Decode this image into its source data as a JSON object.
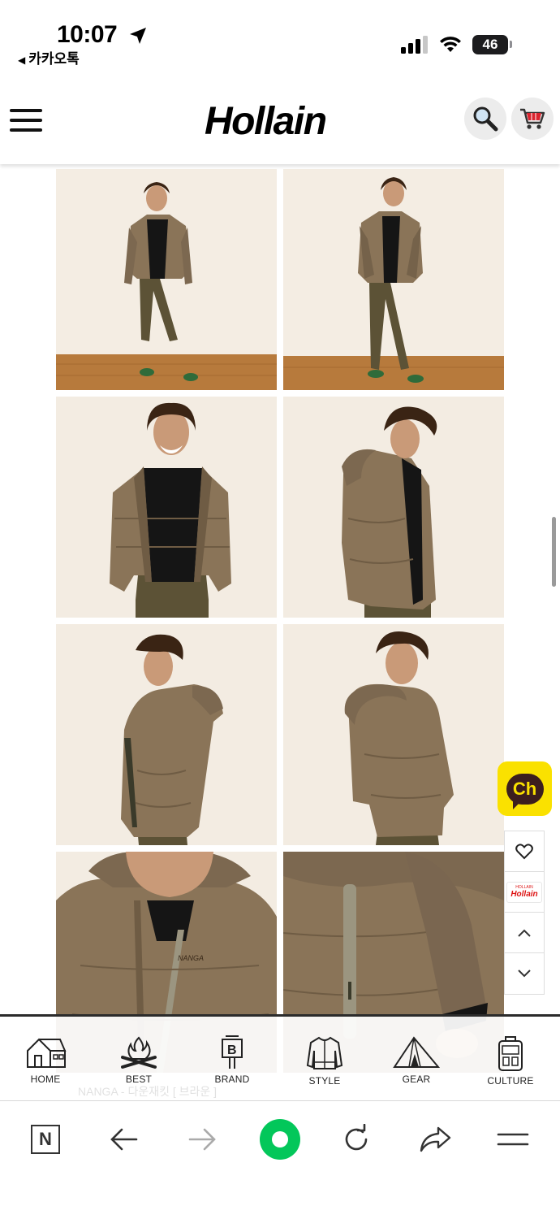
{
  "status_bar": {
    "time": "10:07",
    "back_app": "카카오톡",
    "battery": "46",
    "icons": [
      "location-arrow-icon",
      "cellular-signal-icon",
      "wifi-icon",
      "battery-icon"
    ]
  },
  "header": {
    "logo": "Hollain",
    "menu_icon": "hamburger-menu-icon",
    "search_icon": "magnifier-icon",
    "cart_icon": "shopping-cart-icon"
  },
  "gallery": {
    "colors": {
      "jacket": "#8a7458",
      "jacket_shadow": "#6f5c44",
      "pants": "#5c5236",
      "shirt": "#151515",
      "backdrop": "#f3ece2",
      "floor": "#b77a3c",
      "skin": "#c99a78",
      "hair": "#3a2414"
    },
    "photos": [
      {
        "view": "full-body-front"
      },
      {
        "view": "full-body-front-hands-pockets"
      },
      {
        "view": "upper-body-front-smiling"
      },
      {
        "view": "upper-body-three-quarter"
      },
      {
        "view": "side-profile"
      },
      {
        "view": "back-view-hood"
      },
      {
        "view": "close-up-collar-zipper"
      },
      {
        "view": "close-up-sleeve-pocket"
      }
    ]
  },
  "floating": {
    "channel_label": "Ch",
    "mini_logo_brand": "Hollain",
    "mini_logo_small": "HOLLAIN",
    "icons": [
      "heart-icon",
      "chevron-up-icon",
      "chevron-down-icon"
    ]
  },
  "bottom_nav": {
    "items": [
      {
        "label": "HOME",
        "icon": "house-icon"
      },
      {
        "label": "BEST",
        "icon": "campfire-icon"
      },
      {
        "label": "BRAND",
        "icon": "signpost-icon"
      },
      {
        "label": "STYLE",
        "icon": "sweater-icon"
      },
      {
        "label": "GEAR",
        "icon": "tent-icon"
      },
      {
        "label": "CULTURE",
        "icon": "backpack-icon"
      }
    ],
    "ghost_text": "NANGA - 다운재킷 [ 브라운 ]"
  },
  "browser_toolbar": {
    "n_label": "N",
    "icons": [
      "naver-n-icon",
      "back-arrow-icon",
      "forward-arrow-icon",
      "green-home-icon",
      "reload-icon",
      "share-icon",
      "more-menu-icon"
    ]
  }
}
